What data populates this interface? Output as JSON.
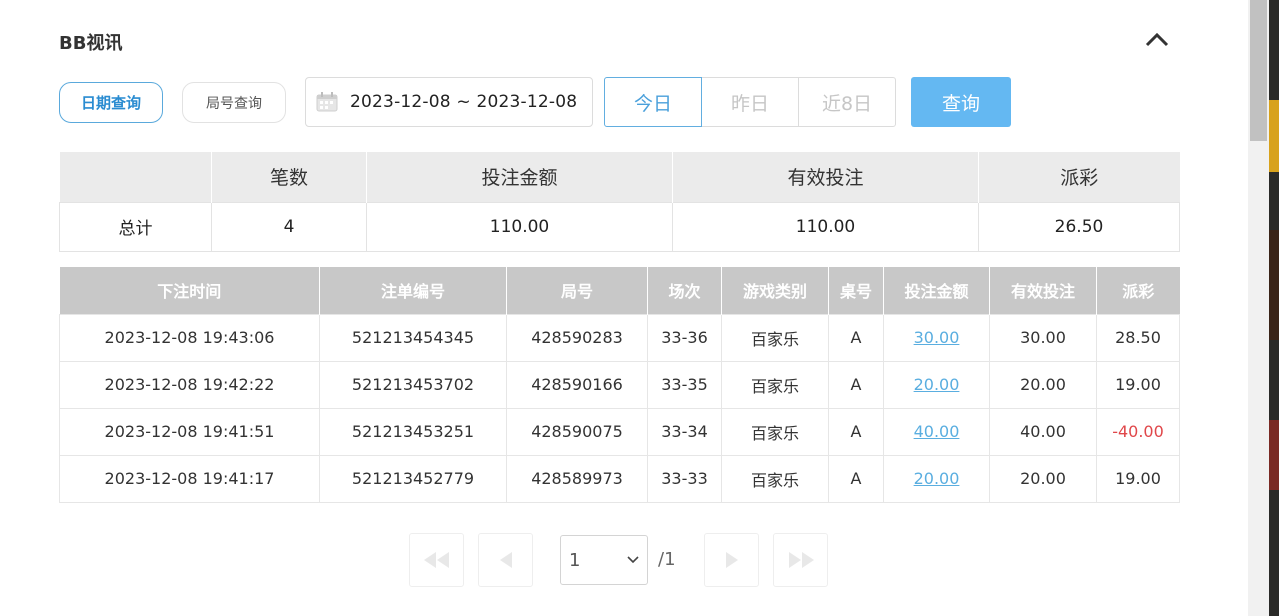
{
  "panel": {
    "title": "BB视讯"
  },
  "filters": {
    "mode_tabs": [
      "日期查询",
      "局号查询"
    ],
    "date_range": "2023-12-08 ~ 2023-12-08",
    "quick": [
      "今日",
      "昨日",
      "近8日"
    ],
    "query_label": "查询"
  },
  "summary": {
    "headers": [
      "",
      "笔数",
      "投注金额",
      "有效投注",
      "派彩"
    ],
    "row": [
      "总计",
      "4",
      "110.00",
      "110.00",
      "26.50"
    ]
  },
  "detail": {
    "headers": [
      "下注时间",
      "注单编号",
      "局号",
      "场次",
      "游戏类别",
      "桌号",
      "投注金额",
      "有效投注",
      "派彩"
    ],
    "rows": [
      [
        "2023-12-08 19:43:06",
        "521213454345",
        "428590283",
        "33-36",
        "百家乐",
        "A",
        "30.00",
        "30.00",
        "28.50"
      ],
      [
        "2023-12-08 19:42:22",
        "521213453702",
        "428590166",
        "33-35",
        "百家乐",
        "A",
        "20.00",
        "20.00",
        "19.00"
      ],
      [
        "2023-12-08 19:41:51",
        "521213453251",
        "428590075",
        "33-34",
        "百家乐",
        "A",
        "40.00",
        "40.00",
        "-40.00"
      ],
      [
        "2023-12-08 19:41:17",
        "521213452779",
        "428589973",
        "33-33",
        "百家乐",
        "A",
        "20.00",
        "20.00",
        "19.00"
      ]
    ]
  },
  "pagination": {
    "current": "1",
    "total": "/1"
  },
  "colors": {
    "accent": "#64b8f2",
    "link": "#5aaee0",
    "negative": "#e0474a"
  }
}
